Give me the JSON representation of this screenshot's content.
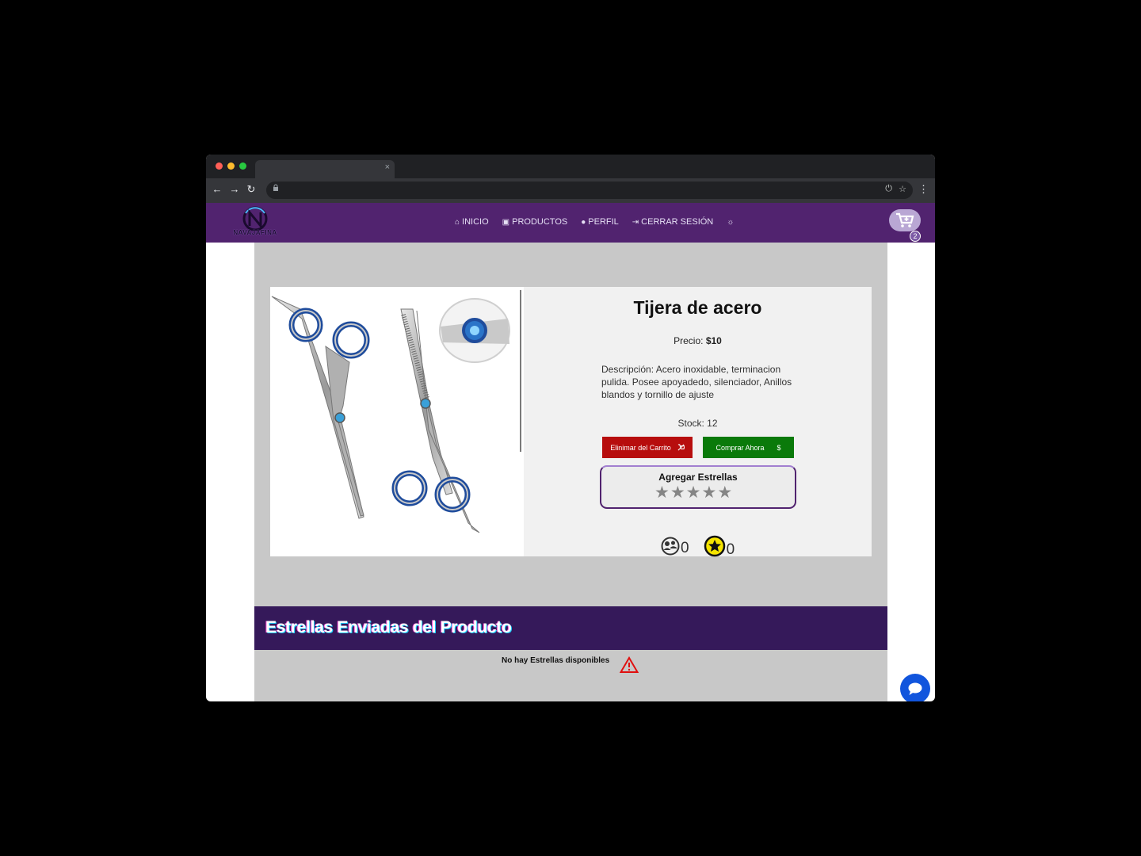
{
  "browser": {
    "tab_close": "×",
    "back": "←",
    "forward": "→",
    "reload": "↻",
    "lock": "🔒",
    "menu": "⋮"
  },
  "site": {
    "logo_text": "NAVAJAFINA",
    "nav": [
      {
        "icon": "home-icon",
        "label": "INICIO"
      },
      {
        "icon": "bag-icon",
        "label": "PRODUCTOS"
      },
      {
        "icon": "user-icon",
        "label": "PERFIL"
      },
      {
        "icon": "sign-out-icon",
        "label": "CERRAR SESIÓN"
      }
    ],
    "cart_count": "2"
  },
  "product": {
    "title": "Tijera de acero",
    "price_label": "Precio:",
    "price_value": "$10",
    "description": "Descripción: Acero inoxidable, terminacion pulida. Posee apoyadedo, silenciador, Anillos blandos y tornillo de ajuste",
    "stock": "Stock: 12",
    "remove_button": "Elinimar del Carrito",
    "buy_button": "Comprar Ahora",
    "buy_symbol": "$",
    "stars_title": "Agregar Estrellas",
    "rating_max": 5,
    "rating_selected": 0,
    "users_count": "0",
    "stars_count": "0"
  },
  "reviews": {
    "title": "Estrellas Enviadas del Producto",
    "empty_text": "No hay Estrellas disponibles"
  },
  "colors": {
    "nav_bg": "#51236f",
    "reviews_header_bg": "#35195a",
    "remove_button": "#b70d0d",
    "buy_button": "#0a7a0a",
    "chat_button": "#1155dd"
  }
}
